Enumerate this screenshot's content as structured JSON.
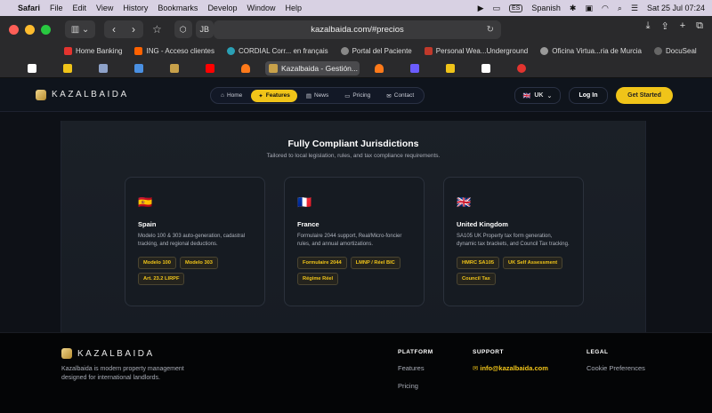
{
  "menubar": {
    "app": "Safari",
    "items": [
      "File",
      "Edit",
      "View",
      "History",
      "Bookmarks",
      "Develop",
      "Window",
      "Help"
    ],
    "input_badge": "ES",
    "input_label": "Spanish",
    "datetime": "Sat 25 Jul 07:24"
  },
  "browser": {
    "url": "kazalbaida.com/#precios",
    "ext_label": "JB",
    "favorites": [
      {
        "label": "Home Banking",
        "color": "#e3342f"
      },
      {
        "label": "ING - Acceso clientes",
        "color": "#ff6200"
      },
      {
        "label": "CORDIAL Corr... en français",
        "color": "#2aa0b5"
      },
      {
        "label": "Portal del Paciente",
        "color": "#888888"
      },
      {
        "label": "Personal Wea...Underground",
        "color": "#c0392b"
      },
      {
        "label": "Oficina Virtua...ria de Murcia",
        "color": "#999999"
      },
      {
        "label": "DocuSeal",
        "color": "#666666"
      }
    ],
    "active_tab": "Kazalbaida - Gestión...",
    "tab_icons": [
      "#ffffff",
      "#f0c419",
      "#8ea2c9",
      "#4a90e2",
      "#c8a14a",
      "#ff0000",
      "#ff7a1a",
      "#c8a14a",
      "#ff7a1a",
      "#6b5cff",
      "#f0c419",
      "#ffffff",
      "#e3342f"
    ]
  },
  "site": {
    "brand": "KAZALBAIDA",
    "nav": [
      {
        "label": "Home",
        "icon": "home-icon",
        "glyph": "⌂"
      },
      {
        "label": "Features",
        "icon": "sparkle-icon",
        "glyph": "✦"
      },
      {
        "label": "News",
        "icon": "news-icon",
        "glyph": "▤"
      },
      {
        "label": "Pricing",
        "icon": "card-icon",
        "glyph": "▭"
      },
      {
        "label": "Contact",
        "icon": "mail-icon",
        "glyph": "✉"
      }
    ],
    "active_nav": "Features",
    "lang": "UK",
    "login": "Log In",
    "cta": "Get Started",
    "section_title": "Fully Compliant Jurisdictions",
    "section_subtitle": "Tailored to local legislation, rules, and tax compliance requirements.",
    "cards": [
      {
        "flag": "🇪🇸",
        "name": "Spain",
        "desc": "Modelo 100 & 303 auto-generation, cadastral tracking, and regional deductions.",
        "chips": [
          "Modelo 100",
          "Modelo 303",
          "Art. 23.2 LIRPF"
        ]
      },
      {
        "flag": "🇫🇷",
        "name": "France",
        "desc": "Formulaire 2044 support, Real/Micro-foncier rules, and annual amortizations.",
        "chips": [
          "Formulaire 2044",
          "LMNP / Réel BIC",
          "Régime Réel"
        ]
      },
      {
        "flag": "🇬🇧",
        "name": "United Kingdom",
        "desc": "SA105 UK Property tax form generation, dynamic tax brackets, and Council Tax tracking.",
        "chips": [
          "HMRC SA105",
          "UK Self Assessment",
          "Council Tax"
        ]
      }
    ],
    "footer": {
      "desc": "Kazalbaida is modern property management designed for international landlords.",
      "platform": {
        "heading": "PLATFORM",
        "links": [
          "Features",
          "Pricing"
        ]
      },
      "support": {
        "heading": "SUPPORT",
        "email": "info@kazalbaida.com"
      },
      "legal": {
        "heading": "LEGAL",
        "links": [
          "Cookie Preferences"
        ]
      }
    }
  },
  "colors": {
    "accent": "#f0c419",
    "background": "#0e1117"
  }
}
